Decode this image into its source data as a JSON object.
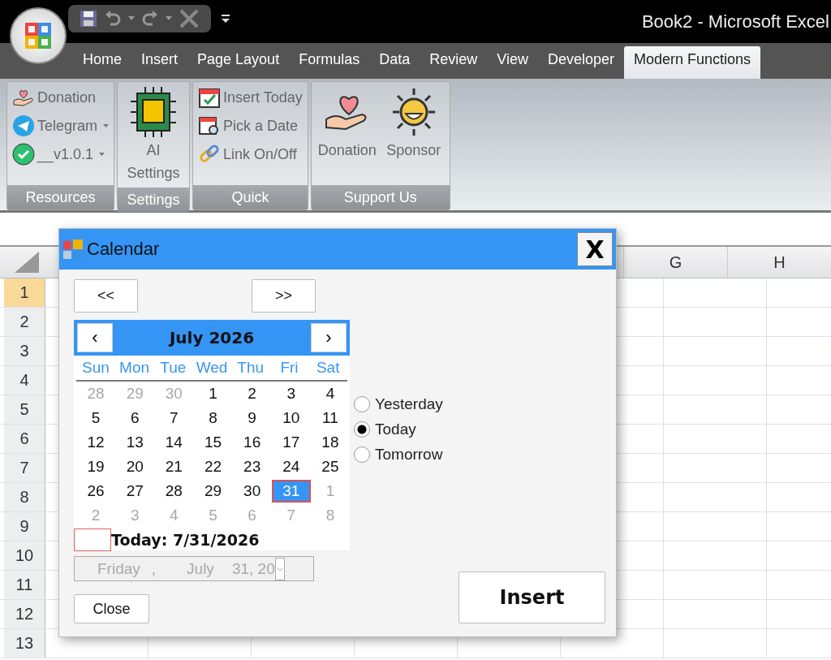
{
  "window": {
    "title": "Book2 - Microsoft Excel"
  },
  "tabs": [
    {
      "label": "Home",
      "selected": false
    },
    {
      "label": "Insert",
      "selected": false
    },
    {
      "label": "Page Layout",
      "selected": false
    },
    {
      "label": "Formulas",
      "selected": false
    },
    {
      "label": "Data",
      "selected": false
    },
    {
      "label": "Review",
      "selected": false
    },
    {
      "label": "View",
      "selected": false
    },
    {
      "label": "Developer",
      "selected": false
    },
    {
      "label": "Modern Functions",
      "selected": true
    }
  ],
  "ribbon": {
    "groups": [
      {
        "label": "Resources",
        "items": [
          {
            "label": "Donation",
            "kind": "small",
            "dropdown": false
          },
          {
            "label": "Telegram",
            "kind": "small",
            "dropdown": true
          },
          {
            "label": "__v1.0.1",
            "kind": "small",
            "dropdown": true
          }
        ]
      },
      {
        "label": "Settings",
        "items": [
          {
            "label": "AI Settings",
            "kind": "large",
            "dropdown": false
          }
        ]
      },
      {
        "label": "Quick",
        "items": [
          {
            "label": "Insert Today",
            "kind": "small",
            "dropdown": false
          },
          {
            "label": "Pick a Date",
            "kind": "small",
            "dropdown": false
          },
          {
            "label": "Link On/Off",
            "kind": "small",
            "dropdown": false
          }
        ]
      },
      {
        "label": "Support Us",
        "items": [
          {
            "label": "Donation",
            "kind": "large",
            "dropdown": false
          },
          {
            "label": "Sponsor",
            "kind": "large",
            "dropdown": false
          }
        ]
      }
    ]
  },
  "sheet": {
    "columns": [
      "G",
      "H"
    ],
    "rows": [
      {
        "label": "1",
        "selected": true
      },
      {
        "label": "2",
        "selected": false
      },
      {
        "label": "3",
        "selected": false
      },
      {
        "label": "4",
        "selected": false
      },
      {
        "label": "5",
        "selected": false
      },
      {
        "label": "6",
        "selected": false
      },
      {
        "label": "7",
        "selected": false
      },
      {
        "label": "8",
        "selected": false
      },
      {
        "label": "9",
        "selected": false
      },
      {
        "label": "10",
        "selected": false
      },
      {
        "label": "11",
        "selected": false
      },
      {
        "label": "12",
        "selected": false
      },
      {
        "label": "13",
        "selected": false
      }
    ]
  },
  "dialog": {
    "title": "Calendar",
    "close": "X",
    "prev_year": "<<",
    "next_year": ">>",
    "prev_month": "‹",
    "next_month": "›",
    "month_title": "July 2026",
    "weekdays": [
      "Sun",
      "Mon",
      "Tue",
      "Wed",
      "Thu",
      "Fri",
      "Sat"
    ],
    "weeks": [
      [
        {
          "day": "28",
          "other_month": true,
          "selected": false
        },
        {
          "day": "29",
          "other_month": true,
          "selected": false
        },
        {
          "day": "30",
          "other_month": true,
          "selected": false
        },
        {
          "day": "1",
          "other_month": false,
          "selected": false
        },
        {
          "day": "2",
          "other_month": false,
          "selected": false
        },
        {
          "day": "3",
          "other_month": false,
          "selected": false
        },
        {
          "day": "4",
          "other_month": false,
          "selected": false
        }
      ],
      [
        {
          "day": "5",
          "other_month": false,
          "selected": false
        },
        {
          "day": "6",
          "other_month": false,
          "selected": false
        },
        {
          "day": "7",
          "other_month": false,
          "selected": false
        },
        {
          "day": "8",
          "other_month": false,
          "selected": false
        },
        {
          "day": "9",
          "other_month": false,
          "selected": false
        },
        {
          "day": "10",
          "other_month": false,
          "selected": false
        },
        {
          "day": "11",
          "other_month": false,
          "selected": false
        }
      ],
      [
        {
          "day": "12",
          "other_month": false,
          "selected": false
        },
        {
          "day": "13",
          "other_month": false,
          "selected": false
        },
        {
          "day": "14",
          "other_month": false,
          "selected": false
        },
        {
          "day": "15",
          "other_month": false,
          "selected": false
        },
        {
          "day": "16",
          "other_month": false,
          "selected": false
        },
        {
          "day": "17",
          "other_month": false,
          "selected": false
        },
        {
          "day": "18",
          "other_month": false,
          "selected": false
        }
      ],
      [
        {
          "day": "19",
          "other_month": false,
          "selected": false
        },
        {
          "day": "20",
          "other_month": false,
          "selected": false
        },
        {
          "day": "21",
          "other_month": false,
          "selected": false
        },
        {
          "day": "22",
          "other_month": false,
          "selected": false
        },
        {
          "day": "23",
          "other_month": false,
          "selected": false
        },
        {
          "day": "24",
          "other_month": false,
          "selected": false
        },
        {
          "day": "25",
          "other_month": false,
          "selected": false
        }
      ],
      [
        {
          "day": "26",
          "other_month": false,
          "selected": false
        },
        {
          "day": "27",
          "other_month": false,
          "selected": false
        },
        {
          "day": "28",
          "other_month": false,
          "selected": false
        },
        {
          "day": "29",
          "other_month": false,
          "selected": false
        },
        {
          "day": "30",
          "other_month": false,
          "selected": false
        },
        {
          "day": "31",
          "other_month": false,
          "selected": true
        },
        {
          "day": "1",
          "other_month": true,
          "selected": false
        }
      ],
      [
        {
          "day": "2",
          "other_month": true,
          "selected": false
        },
        {
          "day": "3",
          "other_month": true,
          "selected": false
        },
        {
          "day": "4",
          "other_month": true,
          "selected": false
        },
        {
          "day": "5",
          "other_month": true,
          "selected": false
        },
        {
          "day": "6",
          "other_month": true,
          "selected": false
        },
        {
          "day": "7",
          "other_month": true,
          "selected": false
        },
        {
          "day": "8",
          "other_month": true,
          "selected": false
        }
      ]
    ],
    "today_label": "Today: 7/31/2026",
    "date_picker": {
      "disabled": true,
      "parts": [
        "Friday",
        ",",
        "July",
        "31, 20"
      ]
    },
    "options": [
      {
        "label": "Yesterday",
        "selected": false
      },
      {
        "label": "Today",
        "selected": true
      },
      {
        "label": "Tomorrow",
        "selected": false
      }
    ],
    "close_button": "Close",
    "insert_button": "Insert"
  }
}
